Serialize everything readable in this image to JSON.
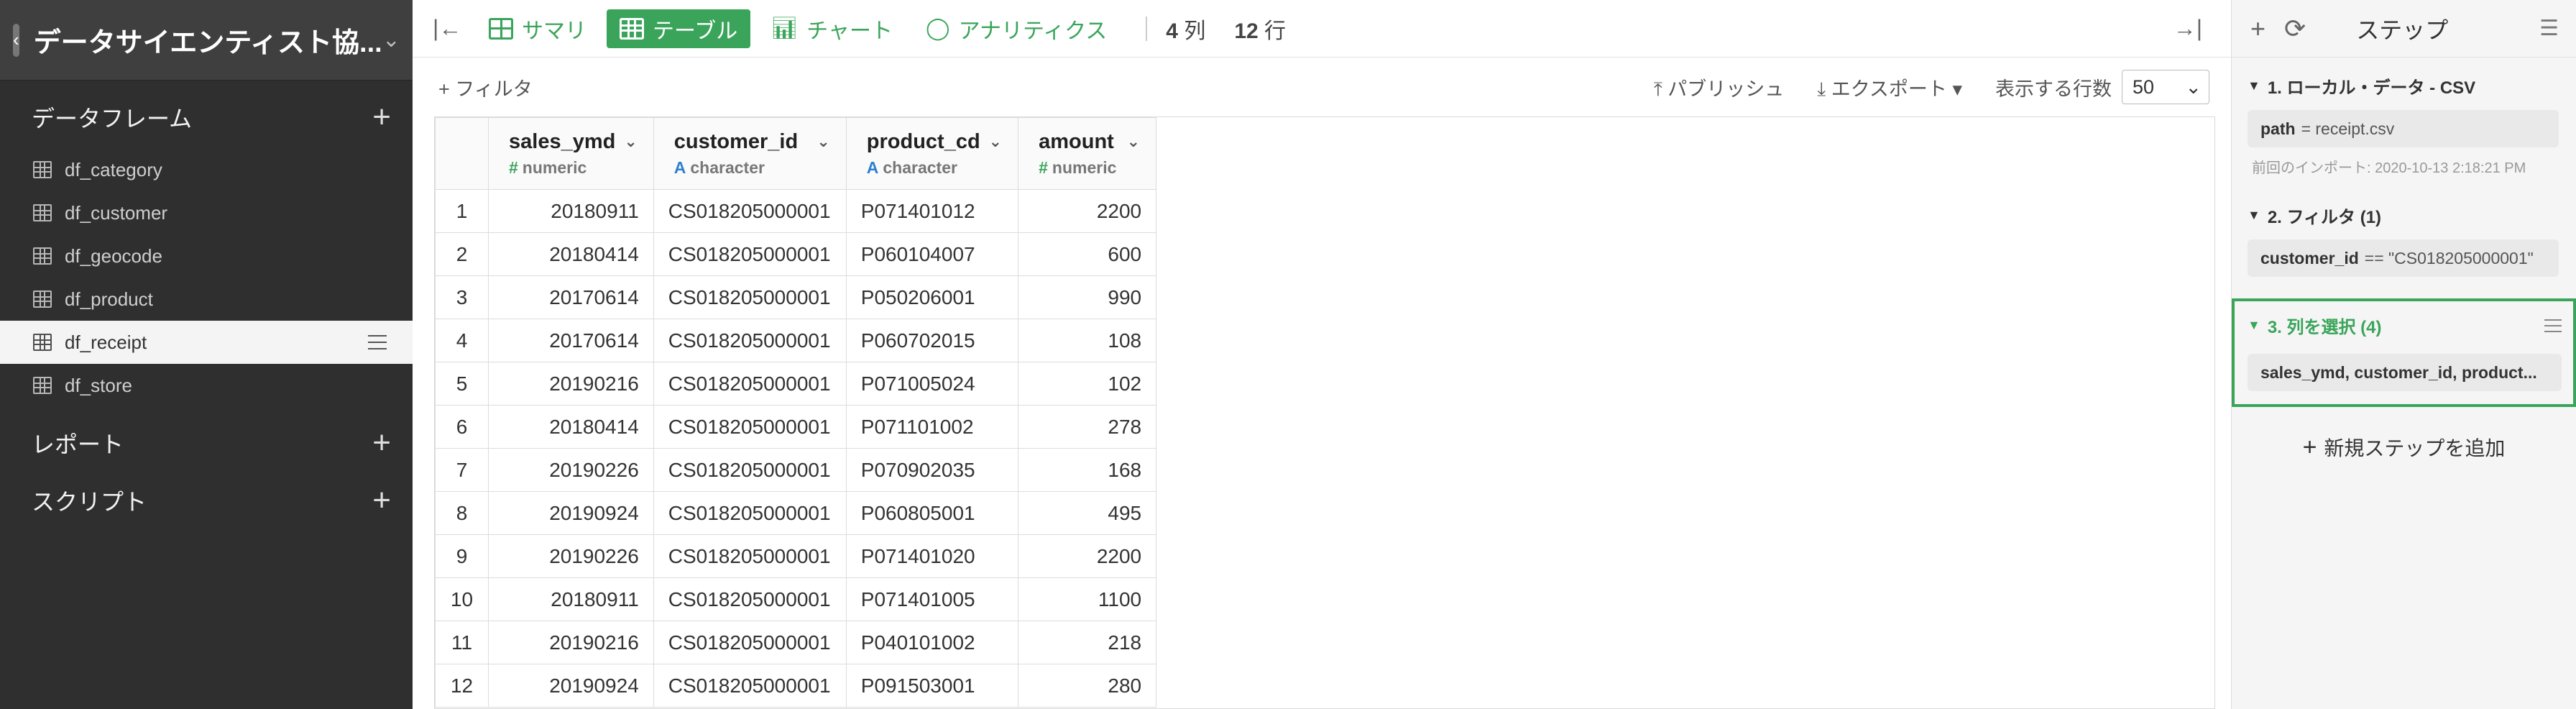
{
  "sidebar": {
    "project_title": "データサイエンティスト協...",
    "dataframes_label": "データフレーム",
    "dataframes": [
      "df_category",
      "df_customer",
      "df_geocode",
      "df_product",
      "df_receipt",
      "df_store"
    ],
    "active_dataframe": "df_receipt",
    "reports_label": "レポート",
    "scripts_label": "スクリプト"
  },
  "toolbar": {
    "tabs": [
      "サマリ",
      "テーブル",
      "チャート",
      "アナリティクス"
    ],
    "active_tab": "テーブル",
    "columns_count": "4",
    "columns_unit": "列",
    "rows_count": "12",
    "rows_unit": "行"
  },
  "subbar": {
    "filter_label": "+ フィルタ",
    "publish_label": "パブリッシュ",
    "export_label": "エクスポート",
    "rows_display_label": "表示する行数",
    "rows_display_value": "50"
  },
  "table": {
    "columns": [
      {
        "name": "sales_ymd",
        "type": "numeric"
      },
      {
        "name": "customer_id",
        "type": "character"
      },
      {
        "name": "product_cd",
        "type": "character"
      },
      {
        "name": "amount",
        "type": "numeric"
      }
    ],
    "rows": [
      [
        "1",
        "20180911",
        "CS018205000001",
        "P071401012",
        "2200"
      ],
      [
        "2",
        "20180414",
        "CS018205000001",
        "P060104007",
        "600"
      ],
      [
        "3",
        "20170614",
        "CS018205000001",
        "P050206001",
        "990"
      ],
      [
        "4",
        "20170614",
        "CS018205000001",
        "P060702015",
        "108"
      ],
      [
        "5",
        "20190216",
        "CS018205000001",
        "P071005024",
        "102"
      ],
      [
        "6",
        "20180414",
        "CS018205000001",
        "P071101002",
        "278"
      ],
      [
        "7",
        "20190226",
        "CS018205000001",
        "P070902035",
        "168"
      ],
      [
        "8",
        "20190924",
        "CS018205000001",
        "P060805001",
        "495"
      ],
      [
        "9",
        "20190226",
        "CS018205000001",
        "P071401020",
        "2200"
      ],
      [
        "10",
        "20180911",
        "CS018205000001",
        "P071401005",
        "1100"
      ],
      [
        "11",
        "20190216",
        "CS018205000001",
        "P040101002",
        "218"
      ],
      [
        "12",
        "20190924",
        "CS018205000001",
        "P091503001",
        "280"
      ]
    ]
  },
  "steps_panel": {
    "title": "ステップ",
    "steps": [
      {
        "title": "1. ローカル・データ - CSV",
        "key": "path",
        "value": "= receipt.csv",
        "note": "前回のインポート: 2020-10-13 2:18:21 PM"
      },
      {
        "title": "2. フィルタ (1)",
        "key": "customer_id",
        "value": "== \"CS018205000001\""
      },
      {
        "title": "3. 列を選択 (4)",
        "value": "sales_ymd, customer_id, product..."
      }
    ],
    "add_step_label": "新規ステップを追加"
  },
  "colors": {
    "accent": "#3aa55a",
    "sidebar_bg": "#2f2f2f",
    "char_type": "#2f7fd1"
  }
}
